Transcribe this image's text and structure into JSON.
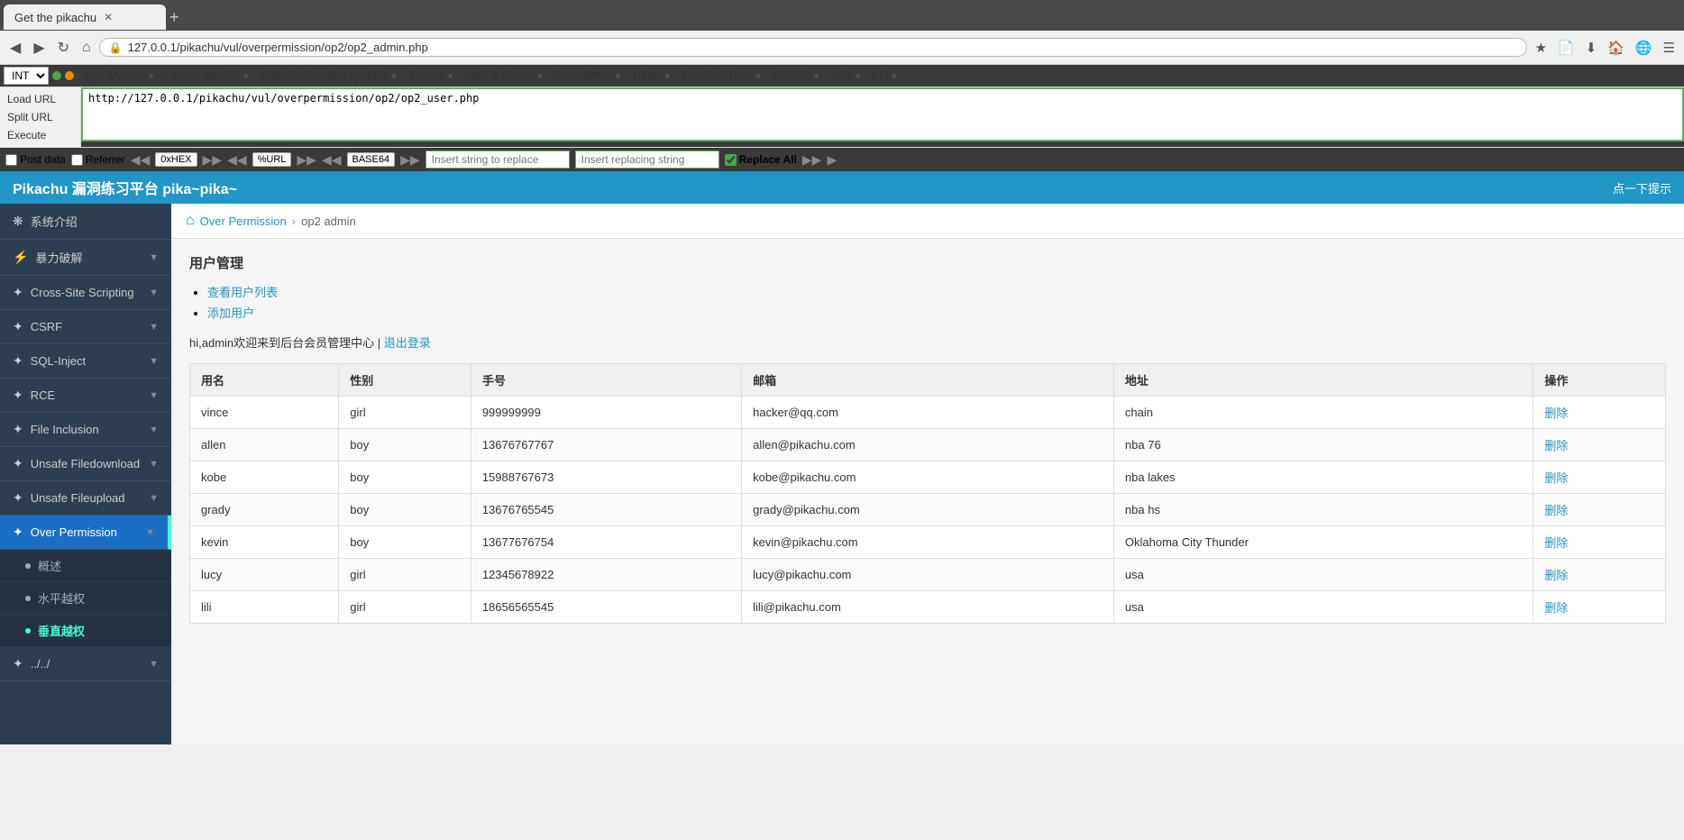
{
  "browser": {
    "tab_title": "Get the pikachu",
    "url": "127.0.0.1/pikachu/vul/overpermission/op2/op2_admin.php",
    "back_btn": "◀",
    "forward_btn": "▶",
    "reload_btn": "↻",
    "home_btn": "⌂",
    "new_tab": "+"
  },
  "hackbar": {
    "select_value": "INT",
    "menus": [
      "SQL BASICS▾",
      "UNION BASED▾",
      "ERROR/DOUBLE QUERY▾",
      "TOOLS▾",
      "WAF BYPASS▾",
      "ENCODING▾",
      "HTML▾",
      "ENCRYPTION▾",
      "OTHER▾",
      "XSS▾",
      "LFI▾"
    ],
    "load_url_label": "Load URL",
    "split_url_label": "Split URL",
    "execute_label": "Execute",
    "url_value": "http://127.0.0.1/pikachu/vul/overpermission/op2/op2_user.php",
    "post_data_label": "Post data",
    "referrer_label": "Referrer",
    "encode_0xhex": "0xHEX",
    "encode_url": "%URL",
    "encode_base64": "BASE64",
    "insert_string_placeholder": "Insert string to replace",
    "insert_replacing_placeholder": "Insert replacing string",
    "replace_all_label": "Replace All",
    "replace_all_checked": true
  },
  "page_header": {
    "title": "Pikachu 漏洞练习平台 pika~pika~",
    "hint_btn": "点一下提示"
  },
  "sidebar": {
    "items": [
      {
        "id": "intro",
        "icon": "❋",
        "label": "系统介绍",
        "has_sub": false
      },
      {
        "id": "brute",
        "icon": "⚡",
        "label": "暴力破解",
        "has_sub": true
      },
      {
        "id": "xss",
        "icon": "✦",
        "label": "Cross-Site Scripting",
        "has_sub": true
      },
      {
        "id": "csrf",
        "icon": "✦",
        "label": "CSRF",
        "has_sub": true
      },
      {
        "id": "sqlinject",
        "icon": "✦",
        "label": "SQL-Inject",
        "has_sub": true
      },
      {
        "id": "rce",
        "icon": "✦",
        "label": "RCE",
        "has_sub": true
      },
      {
        "id": "fileinclusion",
        "icon": "✦",
        "label": "File Inclusion",
        "has_sub": true
      },
      {
        "id": "unsafedownload",
        "icon": "✦",
        "label": "Unsafe Filedownload",
        "has_sub": true
      },
      {
        "id": "unsafeupload",
        "icon": "✦",
        "label": "Unsafe Fileupload",
        "has_sub": true
      },
      {
        "id": "overpermission",
        "icon": "✦",
        "label": "Over Permission",
        "has_sub": true,
        "active": true
      }
    ],
    "sub_items": [
      {
        "id": "overview",
        "label": "概述"
      },
      {
        "id": "horizontal",
        "label": "水平越权"
      },
      {
        "id": "vertical",
        "label": "垂直越权",
        "active": true
      }
    ],
    "extra_item": {
      "id": "extra",
      "label": "../..",
      "has_sub": true
    }
  },
  "breadcrumb": {
    "home_icon": "⌂",
    "parent": "Over Permission",
    "current": "op2 admin"
  },
  "content": {
    "section_title": "用户管理",
    "links": [
      {
        "id": "view-users",
        "text": "查看用户列表",
        "href": "#"
      },
      {
        "id": "add-user",
        "text": "添加用户",
        "href": "#"
      }
    ],
    "welcome": "hi,admin欢迎来到后台会员管理中心",
    "separator": "|",
    "logout_link": "退出登录",
    "table_headers": [
      "用名",
      "性别",
      "手号",
      "邮箱",
      "地址",
      "操作"
    ],
    "table_rows": [
      {
        "username": "vince",
        "gender": "girl",
        "phone": "999999999",
        "email": "hacker@qq.com",
        "address": "chain",
        "action": "删除"
      },
      {
        "username": "allen",
        "gender": "boy",
        "phone": "13676767767",
        "email": "allen@pikachu.com",
        "address": "nba 76",
        "action": "删除"
      },
      {
        "username": "kobe",
        "gender": "boy",
        "phone": "15988767673",
        "email": "kobe@pikachu.com",
        "address": "nba lakes",
        "action": "删除"
      },
      {
        "username": "grady",
        "gender": "boy",
        "phone": "13676765545",
        "email": "grady@pikachu.com",
        "address": "nba hs",
        "action": "删除"
      },
      {
        "username": "kevin",
        "gender": "boy",
        "phone": "13677676754",
        "email": "kevin@pikachu.com",
        "address": "Oklahoma City Thunder",
        "action": "删除"
      },
      {
        "username": "lucy",
        "gender": "girl",
        "phone": "12345678922",
        "email": "lucy@pikachu.com",
        "address": "usa",
        "action": "删除"
      },
      {
        "username": "lili",
        "gender": "girl",
        "phone": "18656565545",
        "email": "lili@pikachu.com",
        "address": "usa",
        "action": "删除"
      }
    ]
  },
  "colors": {
    "primary_blue": "#2196c7",
    "sidebar_bg": "#2c3e50",
    "active_green": "#4fc",
    "hackbar_border": "#6a6"
  }
}
